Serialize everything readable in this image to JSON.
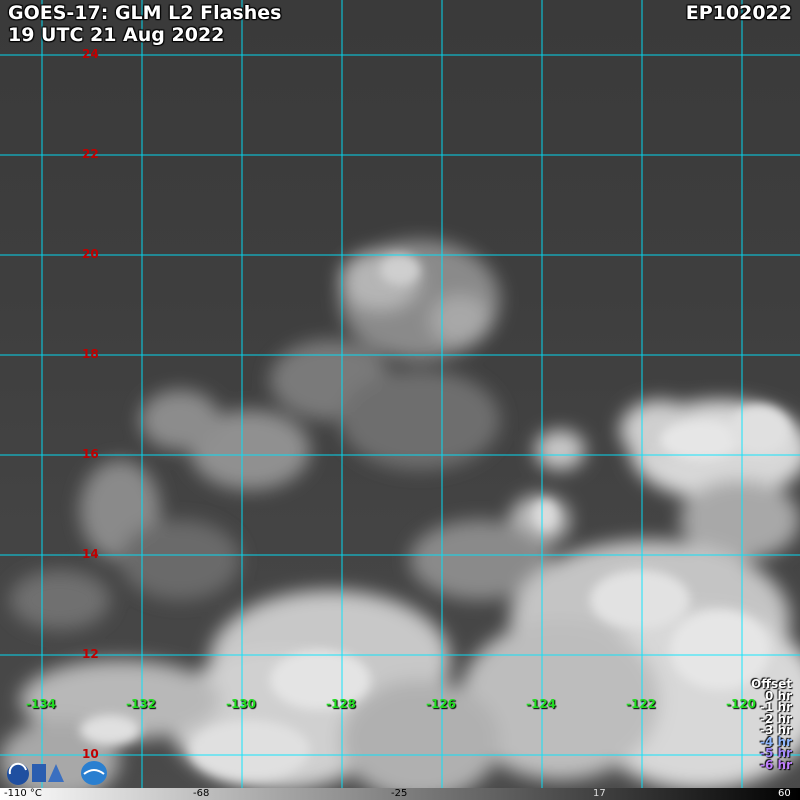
{
  "header": {
    "title": "GOES-17: GLM L2 Flashes",
    "datetime": "19 UTC 21 Aug 2022",
    "storm_id": "EP102022"
  },
  "map": {
    "latitude_labels": [
      "24",
      "22",
      "20",
      "18",
      "16",
      "14",
      "12",
      "10"
    ],
    "longitude_labels": [
      "-134",
      "-132",
      "-130",
      "-128",
      "-126",
      "-124",
      "-122",
      "-120"
    ],
    "grid_color": "#00e5ff",
    "lat_label_color": "#c00000",
    "lon_label_color": "#22dd22"
  },
  "legend": {
    "title": "Offset",
    "items": [
      {
        "label": "0 hr",
        "color": "#ffffff"
      },
      {
        "label": "-1 hr",
        "color": "#ffffff"
      },
      {
        "label": "-2 hr",
        "color": "#ffffff"
      },
      {
        "label": "-3 hr",
        "color": "#ffffff"
      },
      {
        "label": "-4 hr",
        "color": "#8fb8ff"
      },
      {
        "label": "-5 hr",
        "color": "#a78cff"
      },
      {
        "label": "-6 hr",
        "color": "#c080ff"
      }
    ]
  },
  "colorbar": {
    "labels": [
      "-110 °C",
      "-68",
      "-25",
      "17",
      "60"
    ]
  },
  "logo": {
    "name": "cira-rammb-logo"
  }
}
